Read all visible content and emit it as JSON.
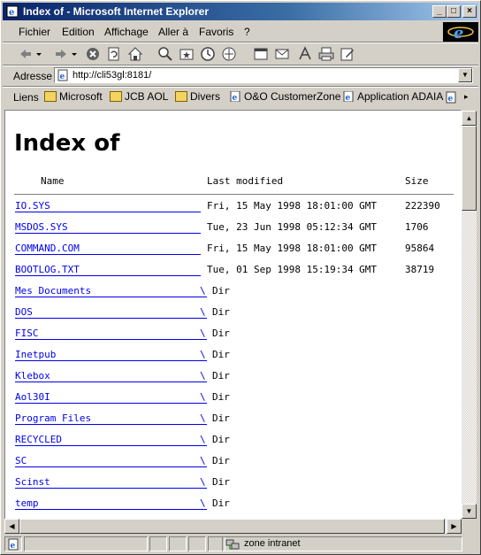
{
  "window": {
    "title": "Index of - Microsoft Internet Explorer",
    "controls": {
      "minimize": "_",
      "maximize": "□",
      "close": "×"
    }
  },
  "menu": {
    "items": [
      "Fichier",
      "Edition",
      "Affichage",
      "Aller à",
      "Favoris",
      "?"
    ]
  },
  "toolbar": {
    "icons": [
      "back-icon",
      "forward-icon",
      "stop-icon",
      "refresh-icon",
      "home-icon",
      "search-icon",
      "favorites-icon",
      "history-icon",
      "channels-icon",
      "fullscreen-icon",
      "mail-icon",
      "font-icon",
      "print-icon",
      "edit-icon"
    ]
  },
  "address": {
    "label": "Adresse",
    "url": "http://cli53gl:8181/"
  },
  "links": {
    "label": "Liens",
    "items": [
      "Microsoft",
      "JCB AOL",
      "Divers",
      "O&O CustomerZone",
      "Application ADAIA"
    ]
  },
  "page": {
    "heading": "Index of",
    "columns": {
      "name": "Name",
      "modified": "Last modified",
      "size": "Size"
    },
    "files": [
      {
        "name": "IO.SYS",
        "modified": "Fri, 15 May 1998 18:01:00 GMT",
        "size": "222390"
      },
      {
        "name": "MSDOS.SYS",
        "modified": "Tue, 23 Jun 1998 05:12:34 GMT",
        "size": "1706"
      },
      {
        "name": "COMMAND.COM",
        "modified": "Fri, 15 May 1998 18:01:00 GMT",
        "size": "95864"
      },
      {
        "name": "BOOTLOG.TXT",
        "modified": "Tue, 01 Sep 1998 15:19:34 GMT",
        "size": "38719"
      }
    ],
    "dirs": [
      {
        "name": "Mes Documents",
        "slash": "\\",
        "type": "Dir"
      },
      {
        "name": "DOS",
        "slash": "\\",
        "type": "Dir"
      },
      {
        "name": "FISC",
        "slash": "\\",
        "type": "Dir"
      },
      {
        "name": "Inetpub",
        "slash": "\\",
        "type": "Dir"
      },
      {
        "name": "Klebox",
        "slash": "\\",
        "type": "Dir"
      },
      {
        "name": "Aol30I",
        "slash": "\\",
        "type": "Dir"
      },
      {
        "name": "Program Files",
        "slash": "\\",
        "type": "Dir"
      },
      {
        "name": "RECYCLED",
        "slash": "\\",
        "type": "Dir"
      },
      {
        "name": "SC",
        "slash": "\\",
        "type": "Dir"
      },
      {
        "name": "Scinst",
        "slash": "\\",
        "type": "Dir"
      },
      {
        "name": "temp",
        "slash": "\\",
        "type": "Dir"
      }
    ]
  },
  "status": {
    "zone": "zone intranet"
  },
  "colors": {
    "titlebar_start": "#0a246a",
    "link": "#0000ee",
    "chrome": "#d4d0c8"
  }
}
